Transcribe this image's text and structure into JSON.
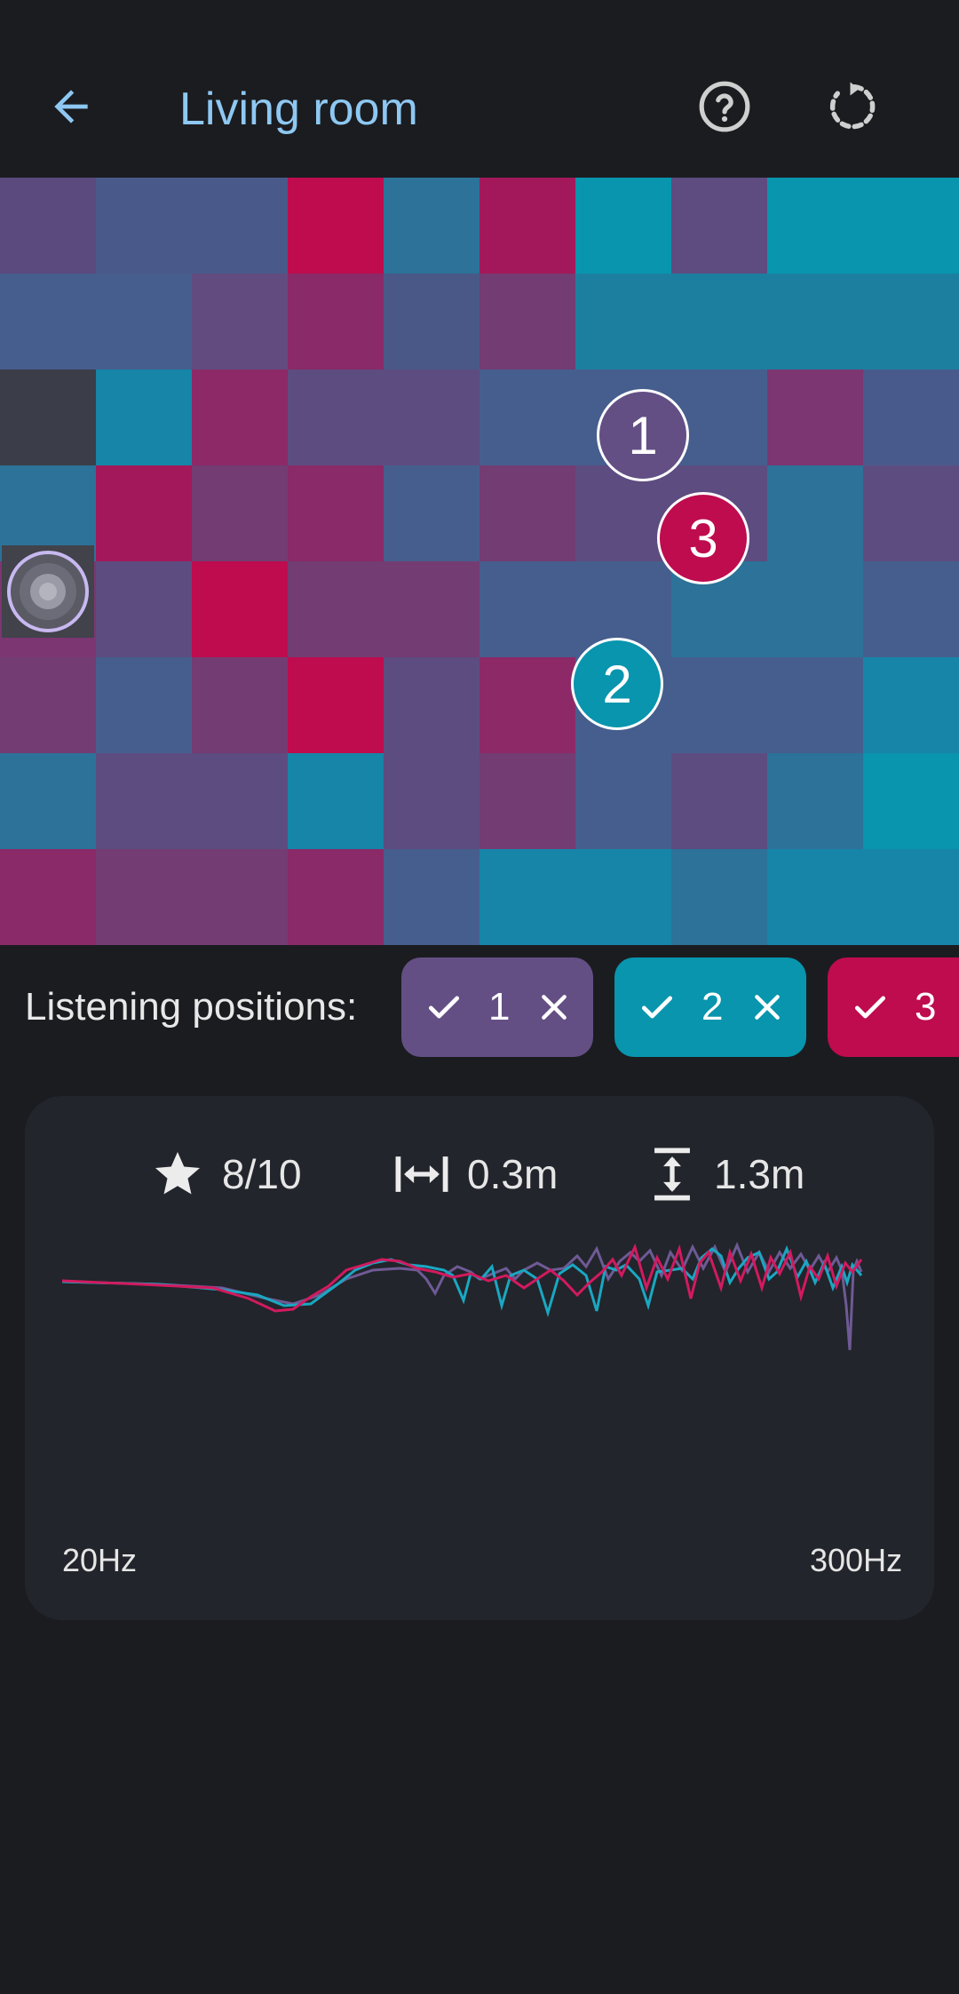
{
  "header": {
    "title": "Living room",
    "back_icon": "arrow-left-icon",
    "help_icon": "help-circle-icon",
    "reset_icon": "reset-icon"
  },
  "colors": {
    "background": "#1b1c20",
    "title": "#8ec8f2",
    "position_1": "#634f84",
    "position_2": "#0895ad",
    "position_3": "#be0c4e",
    "card": "#22252b"
  },
  "room_grid": {
    "positions": [
      {
        "label": "1"
      },
      {
        "label": "2"
      },
      {
        "label": "3"
      }
    ]
  },
  "listening": {
    "label": "Listening positions:",
    "chips": [
      {
        "label": "1"
      },
      {
        "label": "2"
      },
      {
        "label": "3"
      }
    ]
  },
  "stats": {
    "rating": "8/10",
    "width": "0.3m",
    "height": "1.3m"
  },
  "frequency": {
    "min_label": "20Hz",
    "max_label": "300Hz"
  }
}
